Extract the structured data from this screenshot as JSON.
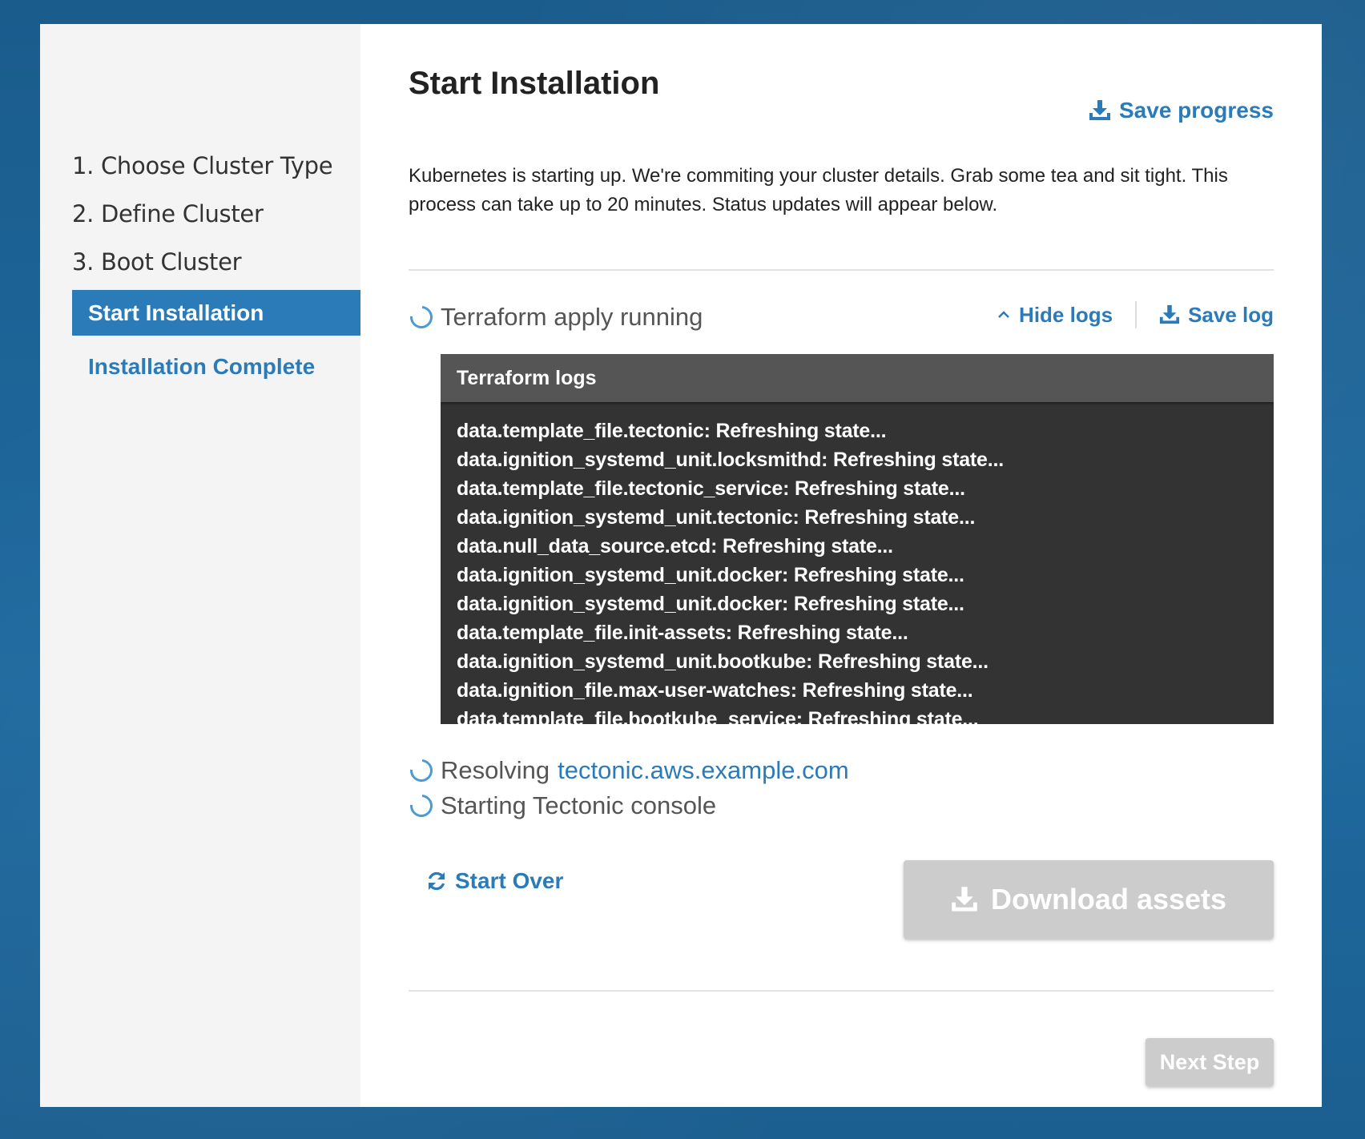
{
  "sidebar": {
    "steps": [
      "1. Choose Cluster Type",
      "2. Define Cluster",
      "3. Boot Cluster"
    ],
    "active_item": "Start Installation",
    "sub_item": "Installation Complete"
  },
  "main": {
    "title": "Start Installation",
    "save_progress": "Save progress",
    "intro": "Kubernetes is starting up. We're commiting your cluster details. Grab some tea and sit tight. This process can take up to 20 minutes. Status updates will appear below.",
    "terraform_status": "Terraform apply running",
    "hide_logs": "Hide logs",
    "save_log": "Save log",
    "log_title": "Terraform logs",
    "log_lines": [
      "data.template_file.tectonic: Refreshing state...",
      "data.ignition_systemd_unit.locksmithd: Refreshing state...",
      "data.template_file.tectonic_service: Refreshing state...",
      "data.ignition_systemd_unit.tectonic: Refreshing state...",
      "data.null_data_source.etcd: Refreshing state...",
      "data.ignition_systemd_unit.docker: Refreshing state...",
      "data.ignition_systemd_unit.docker: Refreshing state...",
      "data.template_file.init-assets: Refreshing state...",
      "data.ignition_systemd_unit.bootkube: Refreshing state...",
      "data.ignition_file.max-user-watches: Refreshing state...",
      "data.template_file.bootkube_service: Refreshing state..."
    ],
    "resolving_label": "Resolving",
    "resolving_host": "tectonic.aws.example.com",
    "console_status": "Starting Tectonic console",
    "start_over": "Start Over",
    "download_assets": "Download assets",
    "next_step": "Next Step"
  },
  "colors": {
    "accent": "#2b7bb9",
    "spinner": "#4a9bd6",
    "disabled_button": "#cccccc",
    "log_background": "#333333",
    "log_header": "#555555"
  },
  "icons": {
    "save_progress": "download-icon",
    "hide_logs": "chevron-up-icon",
    "save_log": "download-icon",
    "start_over": "refresh-icon",
    "download_assets": "download-icon",
    "status": "spinner-icon"
  }
}
